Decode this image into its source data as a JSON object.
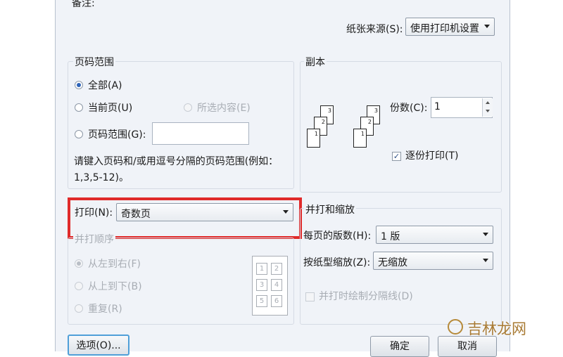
{
  "top": {
    "remark_label": "备注:",
    "paper_source_label": "纸张来源(S):",
    "paper_source_value": "使用打印机设置"
  },
  "page_range": {
    "title": "页码范围",
    "all": "全部(A)",
    "current": "当前页(U)",
    "selection": "所选内容(E)",
    "pages": "页码范围(G):",
    "pages_value": "",
    "hint": "请键入页码和/或用逗号分隔的页码范围(例如：",
    "hint2": "1,3,5-12)。"
  },
  "copies": {
    "title": "副本",
    "count_label": "份数(C):",
    "count_value": "1",
    "collate_label": "逐份打印(T)",
    "collate_checked": true
  },
  "print": {
    "label": "打印(N):",
    "value": "奇数页"
  },
  "order": {
    "title": "并打顺序",
    "ltr": "从左到右(F)",
    "ttb": "从上到下(B)",
    "repeat": "重复(R)",
    "grid": [
      "1",
      "2",
      "3",
      "4",
      "5",
      "6"
    ]
  },
  "zoom": {
    "title": "并打和缩放",
    "per_sheet_label": "每页的版数(H):",
    "per_sheet_value": "1 版",
    "scale_label": "按纸型缩放(Z):",
    "scale_value": "无缩放",
    "draw_lines_label": "并打时绘制分隔线(D)"
  },
  "buttons": {
    "options": "选项(O)...",
    "ok": "确定",
    "cancel": "取消"
  },
  "watermark": {
    "text": "吉林龙网"
  },
  "colors": {
    "highlight": "#e02a2a",
    "accent": "#2d63b8"
  }
}
